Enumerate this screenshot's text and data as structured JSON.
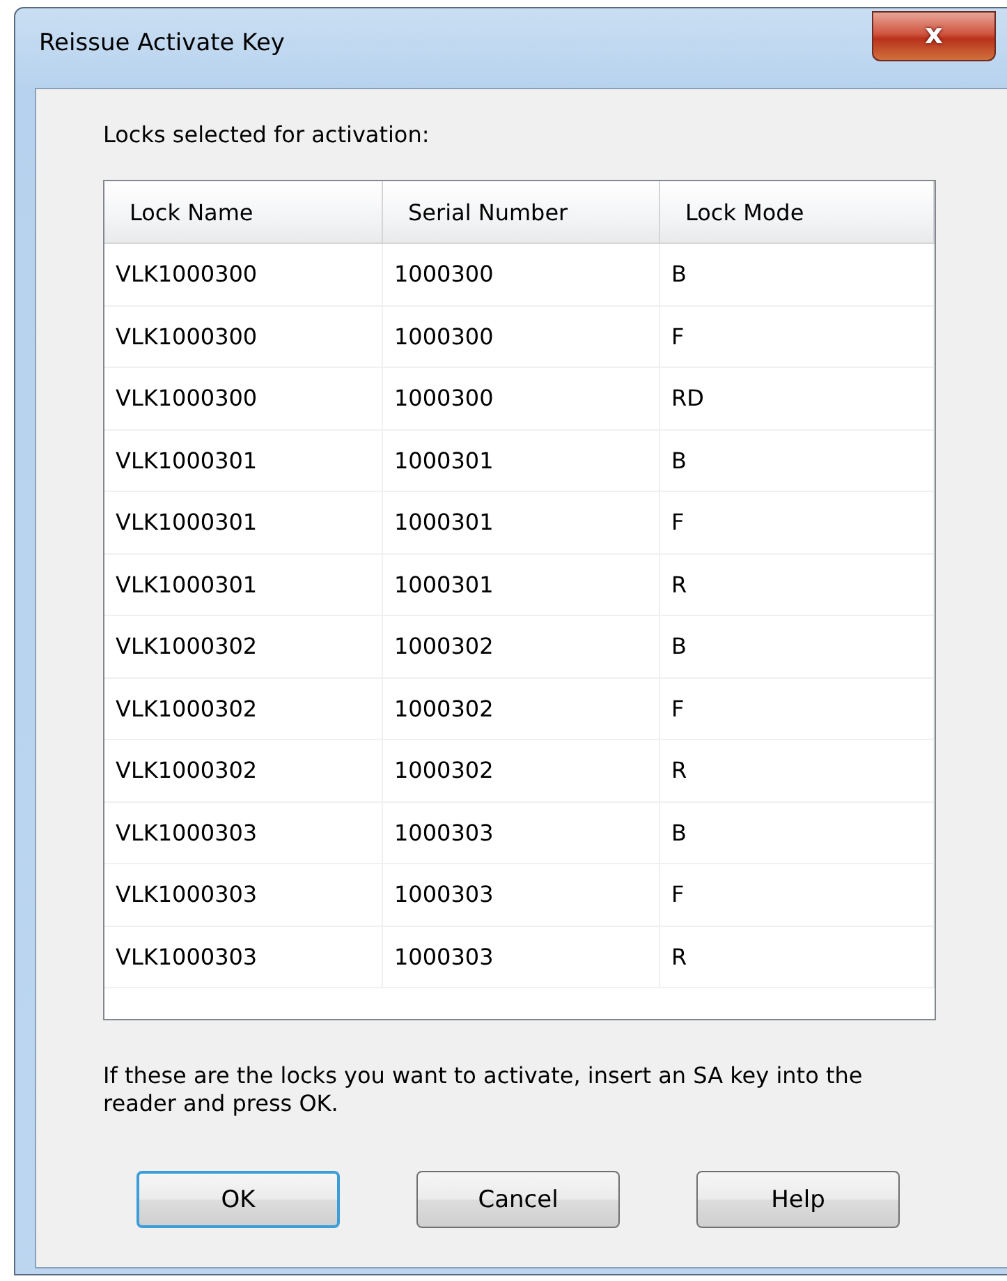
{
  "window": {
    "title": "Reissue Activate Key",
    "close_label": "x"
  },
  "intro": "Locks selected for activation:",
  "table": {
    "columns": [
      "Lock Name",
      "Serial Number",
      "Lock Mode"
    ],
    "rows": [
      [
        "VLK1000300",
        "1000300",
        "B"
      ],
      [
        "VLK1000300",
        "1000300",
        "F"
      ],
      [
        "VLK1000300",
        "1000300",
        "RD"
      ],
      [
        "VLK1000301",
        "1000301",
        "B"
      ],
      [
        "VLK1000301",
        "1000301",
        "F"
      ],
      [
        "VLK1000301",
        "1000301",
        "R"
      ],
      [
        "VLK1000302",
        "1000302",
        "B"
      ],
      [
        "VLK1000302",
        "1000302",
        "F"
      ],
      [
        "VLK1000302",
        "1000302",
        "R"
      ],
      [
        "VLK1000303",
        "1000303",
        "B"
      ],
      [
        "VLK1000303",
        "1000303",
        "F"
      ],
      [
        "VLK1000303",
        "1000303",
        "R"
      ]
    ]
  },
  "instructions": "If these are the locks you want to activate, insert an SA key into the reader and press OK.",
  "buttons": [
    {
      "label": "OK",
      "default": true
    },
    {
      "label": "Cancel",
      "default": false
    },
    {
      "label": "Help",
      "default": false
    }
  ]
}
